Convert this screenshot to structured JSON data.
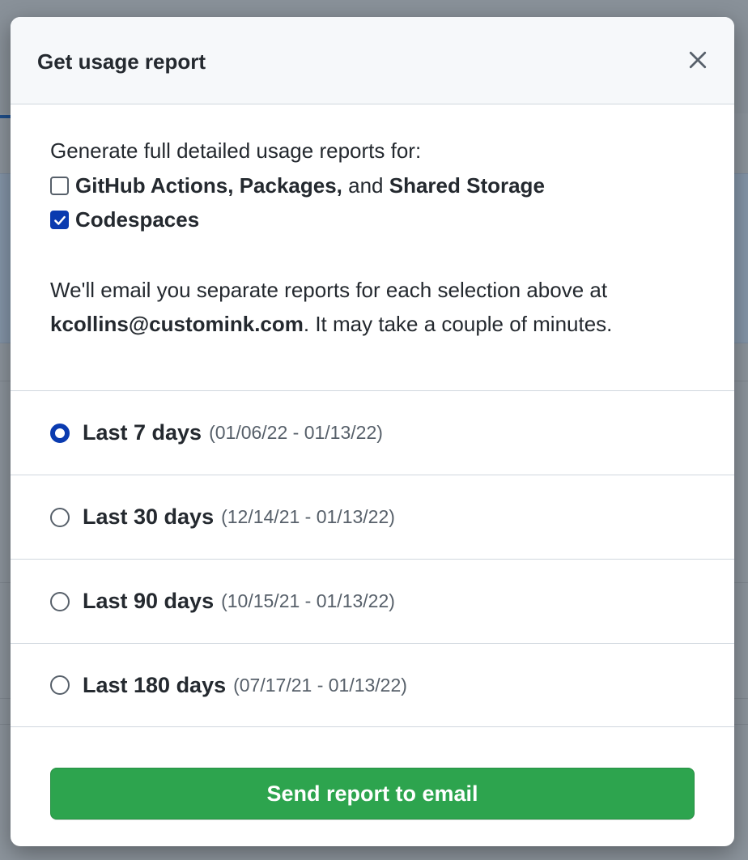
{
  "modal": {
    "title": "Get usage report",
    "close_label": "close"
  },
  "intro": {
    "text": "Generate full detailed usage reports for:"
  },
  "report_types": [
    {
      "parts": [
        "GitHub Actions, Packages,",
        " and ",
        "Shared Storage"
      ],
      "checked": false
    },
    {
      "parts": [
        "Codespaces"
      ],
      "checked": true
    }
  ],
  "email_note": {
    "before": "We'll email you separate reports for each selection above at ",
    "email": "kcollins@customink.com",
    "after": ". It may take a couple of minutes."
  },
  "date_ranges": [
    {
      "label": "Last 7 days",
      "dates": "(01/06/22 - 01/13/22)",
      "selected": true
    },
    {
      "label": "Last 30 days",
      "dates": "(12/14/21 - 01/13/22)",
      "selected": false
    },
    {
      "label": "Last 90 days",
      "dates": "(10/15/21 - 01/13/22)",
      "selected": false
    },
    {
      "label": "Last 180 days",
      "dates": "(07/17/21 - 01/13/22)",
      "selected": false
    }
  ],
  "submit": {
    "label": "Send report to email"
  },
  "colors": {
    "accent": "#0a3bb0",
    "primary_button": "#2da44e",
    "header_bg": "#f6f8fa",
    "border": "#d0d7de"
  },
  "icons": {
    "close": "close-icon",
    "check": "check-icon"
  }
}
